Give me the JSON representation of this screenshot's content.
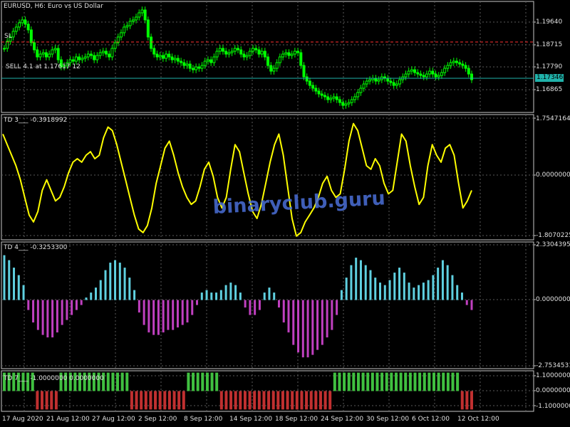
{
  "main_panel": {
    "title": "EURUSD, H6:  Euro vs US Dollar",
    "sl_label": "SL",
    "sell_label": "SELL 4.1 at 1.17617 12",
    "price_tag": "1.17346",
    "axis_labels": [
      "1.19640",
      "1.18715",
      "1.17790",
      "1.16865"
    ],
    "colors": {
      "bull": "#00ff00",
      "bear": "#00ff00",
      "sl_line": "#ff3030",
      "price_line": "#20b2aa"
    }
  },
  "td3_panel": {
    "title": "TD 3___  -0.3918992",
    "axis_labels": [
      "1.7547164",
      "0.0000000",
      "-1.8070225"
    ],
    "line_color": "#ffff00"
  },
  "td4_panel": {
    "title": "TD 4___  -0.3253300",
    "axis_labels": [
      "2.3304395",
      "0.0000000",
      "-2.7534531"
    ],
    "pos_color": "#5fd0e0",
    "neg_color": "#c040c0"
  },
  "td7_panel": {
    "title": "TD 7___  -1.0000000  0.0000000",
    "axis_labels": [
      "1.1000000",
      "0.0000000",
      "-1.1000000"
    ],
    "pos_color": "#40c040",
    "neg_color": "#c03030"
  },
  "time_axis": [
    "17 Aug 2020",
    "21 Aug 12:00",
    "27 Aug 12:00",
    "2 Sep 12:00",
    "8 Sep 12:00",
    "14 Sep 12:00",
    "18 Sep 12:00",
    "24 Sep 12:00",
    "30 Sep 12:00",
    "6 Oct 12:00",
    "12 Oct 12:00"
  ],
  "watermark": "binaryclub.guru",
  "chart_data": [
    {
      "type": "line",
      "name": "EURUSD H6 candles (approximate close series)",
      "ylim": [
        1.1635,
        1.2025
      ],
      "values": [
        1.186,
        1.1885,
        1.19,
        1.192,
        1.1935,
        1.195,
        1.196,
        1.1945,
        1.1925,
        1.188,
        1.1855,
        1.183,
        1.184,
        1.1845,
        1.183,
        1.184,
        1.1855,
        1.186,
        1.182,
        1.1795,
        1.18,
        1.181,
        1.182,
        1.1815,
        1.183,
        1.182,
        1.1825,
        1.183,
        1.184,
        1.1835,
        1.182,
        1.1835,
        1.1845,
        1.185,
        1.184,
        1.183,
        1.186,
        1.188,
        1.19,
        1.1915,
        1.1935,
        1.194,
        1.1955,
        1.196,
        1.197,
        1.1985,
        1.1995,
        1.196,
        1.19,
        1.186,
        1.184,
        1.183,
        1.1835,
        1.1825,
        1.184,
        1.183,
        1.182,
        1.1825,
        1.1815,
        1.181,
        1.18,
        1.1805,
        1.179,
        1.1785,
        1.1795,
        1.179,
        1.18,
        1.1815,
        1.182,
        1.181,
        1.183,
        1.185,
        1.186,
        1.185,
        1.184,
        1.1845,
        1.185,
        1.186,
        1.1855,
        1.184,
        1.183,
        1.1835,
        1.185,
        1.186,
        1.1855,
        1.184,
        1.185,
        1.183,
        1.18,
        1.178,
        1.179,
        1.181,
        1.183,
        1.184,
        1.1845,
        1.1835,
        1.184,
        1.185,
        1.1845,
        1.18,
        1.176,
        1.1745,
        1.173,
        1.172,
        1.171,
        1.17,
        1.1695,
        1.169,
        1.168,
        1.1685,
        1.169,
        1.168,
        1.167,
        1.166,
        1.1665,
        1.167,
        1.168,
        1.169,
        1.1705,
        1.172,
        1.1735,
        1.1745,
        1.175,
        1.1755,
        1.1745,
        1.175,
        1.176,
        1.1755,
        1.1745,
        1.174,
        1.173,
        1.1735,
        1.175,
        1.176,
        1.177,
        1.178,
        1.1785,
        1.1775,
        1.177,
        1.1765,
        1.176,
        1.177,
        1.178,
        1.177,
        1.176,
        1.1765,
        1.1775,
        1.179,
        1.18,
        1.181,
        1.1815,
        1.181,
        1.1805,
        1.18,
        1.179,
        1.177,
        1.175
      ]
    },
    {
      "type": "line",
      "name": "TD 3",
      "ylim": [
        -1.8070225,
        1.7547164
      ],
      "values": [
        1.2,
        0.9,
        0.6,
        0.3,
        -0.1,
        -0.6,
        -1.1,
        -1.3,
        -1.0,
        -0.4,
        -0.1,
        -0.4,
        -0.7,
        -0.6,
        -0.3,
        0.1,
        0.4,
        0.5,
        0.4,
        0.6,
        0.7,
        0.5,
        0.6,
        1.1,
        1.4,
        1.3,
        0.9,
        0.4,
        -0.1,
        -0.6,
        -1.1,
        -1.5,
        -1.6,
        -1.4,
        -0.9,
        -0.2,
        0.3,
        0.8,
        1.0,
        0.6,
        0.1,
        -0.3,
        -0.6,
        -0.8,
        -0.7,
        -0.3,
        0.2,
        0.4,
        0.0,
        -0.6,
        -0.9,
        -0.6,
        0.2,
        0.9,
        0.7,
        0.1,
        -0.5,
        -1.0,
        -1.2,
        -0.8,
        -0.2,
        0.4,
        0.9,
        1.2,
        0.6,
        -0.3,
        -1.2,
        -1.7,
        -1.6,
        -1.3,
        -1.1,
        -0.9,
        -0.6,
        -0.2,
        0.0,
        -0.4,
        -0.6,
        -0.5,
        0.2,
        1.0,
        1.5,
        1.3,
        0.8,
        0.3,
        0.2,
        0.5,
        0.3,
        -0.2,
        -0.5,
        -0.4,
        0.4,
        1.2,
        1.0,
        0.3,
        -0.3,
        -0.8,
        -0.6,
        0.3,
        0.9,
        0.6,
        0.4,
        0.8,
        0.9,
        0.6,
        -0.2,
        -0.9,
        -0.7,
        -0.4
      ]
    },
    {
      "type": "bar",
      "name": "TD 4",
      "ylim": [
        -2.7534531,
        2.3304395
      ],
      "values": [
        1.8,
        1.6,
        1.3,
        1.0,
        0.6,
        -0.4,
        -0.9,
        -1.2,
        -1.4,
        -1.5,
        -1.5,
        -1.3,
        -1.0,
        -0.8,
        -0.6,
        -0.4,
        -0.2,
        0.1,
        0.3,
        0.5,
        0.8,
        1.2,
        1.5,
        1.6,
        1.5,
        1.3,
        0.9,
        0.4,
        -0.5,
        -1.0,
        -1.3,
        -1.4,
        -1.4,
        -1.3,
        -1.2,
        -1.2,
        -1.1,
        -1.0,
        -0.9,
        -0.6,
        -0.2,
        0.3,
        0.4,
        0.3,
        0.3,
        0.4,
        0.6,
        0.7,
        0.6,
        0.3,
        -0.3,
        -0.6,
        -0.6,
        -0.4,
        0.3,
        0.5,
        0.3,
        -0.3,
        -0.9,
        -1.3,
        -1.8,
        -2.1,
        -2.3,
        -2.3,
        -2.2,
        -2.0,
        -1.8,
        -1.5,
        -1.2,
        -0.6,
        0.4,
        0.9,
        1.4,
        1.7,
        1.6,
        1.4,
        1.2,
        0.9,
        0.7,
        0.6,
        0.8,
        1.1,
        1.3,
        1.1,
        0.7,
        0.5,
        0.6,
        0.7,
        0.8,
        1.0,
        1.3,
        1.6,
        1.4,
        1.0,
        0.6,
        0.3,
        -0.2,
        -0.4
      ]
    },
    {
      "type": "bar",
      "name": "TD 7",
      "ylim": [
        -1.1,
        1.1
      ],
      "values": [
        1,
        1,
        1,
        1,
        1,
        1,
        1,
        -1,
        -1,
        -1,
        -1,
        -1,
        1,
        1,
        1,
        1,
        1,
        1,
        1,
        1,
        1,
        1,
        1,
        1,
        1,
        1,
        1,
        -1,
        -1,
        -1,
        -1,
        -1,
        -1,
        -1,
        -1,
        -1,
        -1,
        -1,
        -1,
        1,
        1,
        1,
        1,
        1,
        1,
        1,
        -1,
        -1,
        -1,
        -1,
        -1,
        -1,
        -1,
        -1,
        -1,
        -1,
        -1,
        -1,
        -1,
        -1,
        -1,
        -1,
        -1,
        -1,
        -1,
        -1,
        -1,
        -1,
        -1,
        -1,
        1,
        1,
        1,
        1,
        1,
        1,
        1,
        1,
        1,
        1,
        1,
        1,
        1,
        1,
        1,
        1,
        1,
        1,
        1,
        1,
        1,
        1,
        1,
        1,
        1,
        1,
        1,
        -1,
        -1,
        -1
      ]
    }
  ]
}
